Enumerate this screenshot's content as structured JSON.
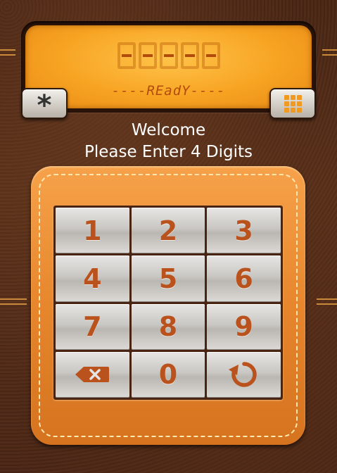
{
  "display": {
    "digits_placeholder": [
      "-",
      "-",
      "-",
      "-",
      "-"
    ],
    "status": "----REadY----"
  },
  "buttons": {
    "star_label": "*"
  },
  "messages": {
    "welcome": "Welcome",
    "instruction": "Please Enter 4 Digits"
  },
  "keypad": {
    "keys": [
      "1",
      "2",
      "3",
      "4",
      "5",
      "6",
      "7",
      "8",
      "9"
    ],
    "zero": "0",
    "backspace_icon": "backspace-icon",
    "reset_icon": "reset-icon"
  },
  "colors": {
    "lcd": "#f7a322",
    "digit": "#b9521d",
    "pad": "#e7862d"
  }
}
